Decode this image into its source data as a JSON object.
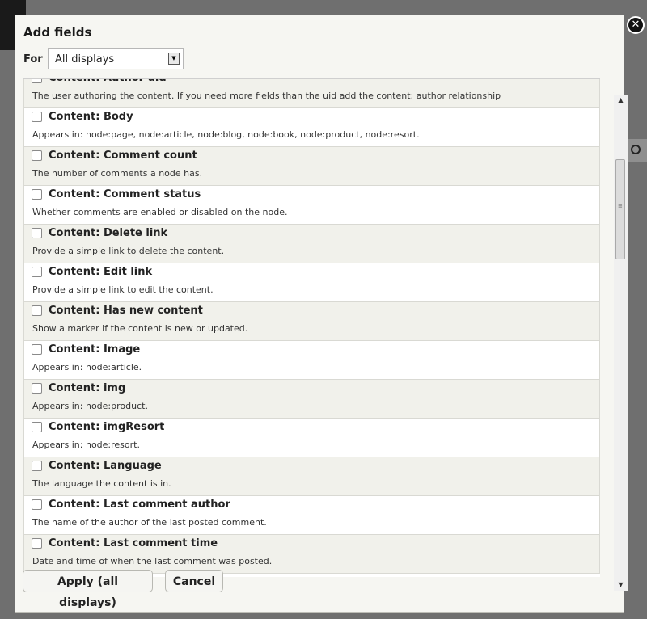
{
  "modal": {
    "title": "Add fields",
    "close_symbol": "✕",
    "for_label": "For",
    "displays_select": {
      "value": "All displays",
      "arrow_icon": "chevron-down-icon"
    }
  },
  "fields": [
    {
      "title": "Content: Author uid",
      "description": "The user authoring the content. If you need more fields than the uid add the content: author relationship"
    },
    {
      "title": "Content: Body",
      "description": "Appears in: node:page, node:article, node:blog, node:book, node:product, node:resort."
    },
    {
      "title": "Content: Comment count",
      "description": "The number of comments a node has."
    },
    {
      "title": "Content: Comment status",
      "description": "Whether comments are enabled or disabled on the node."
    },
    {
      "title": "Content: Delete link",
      "description": "Provide a simple link to delete the content."
    },
    {
      "title": "Content: Edit link",
      "description": "Provide a simple link to edit the content."
    },
    {
      "title": "Content: Has new content",
      "description": "Show a marker if the content is new or updated."
    },
    {
      "title": "Content: Image",
      "description": "Appears in: node:article."
    },
    {
      "title": "Content: img",
      "description": "Appears in: node:product."
    },
    {
      "title": "Content: imgResort",
      "description": "Appears in: node:resort."
    },
    {
      "title": "Content: Language",
      "description": "The language the content is in."
    },
    {
      "title": "Content: Last comment author",
      "description": "The name of the author of the last posted comment."
    },
    {
      "title": "Content: Last comment time",
      "description": "Date and time of when the last comment was posted."
    }
  ],
  "buttons": {
    "apply": "Apply (all displays)",
    "cancel": "Cancel"
  },
  "colors": {
    "overlay": "#6f6f6f",
    "modal_bg": "#f6f6f2",
    "row_alt": "#f1f1eb",
    "close_button": "#111111"
  }
}
